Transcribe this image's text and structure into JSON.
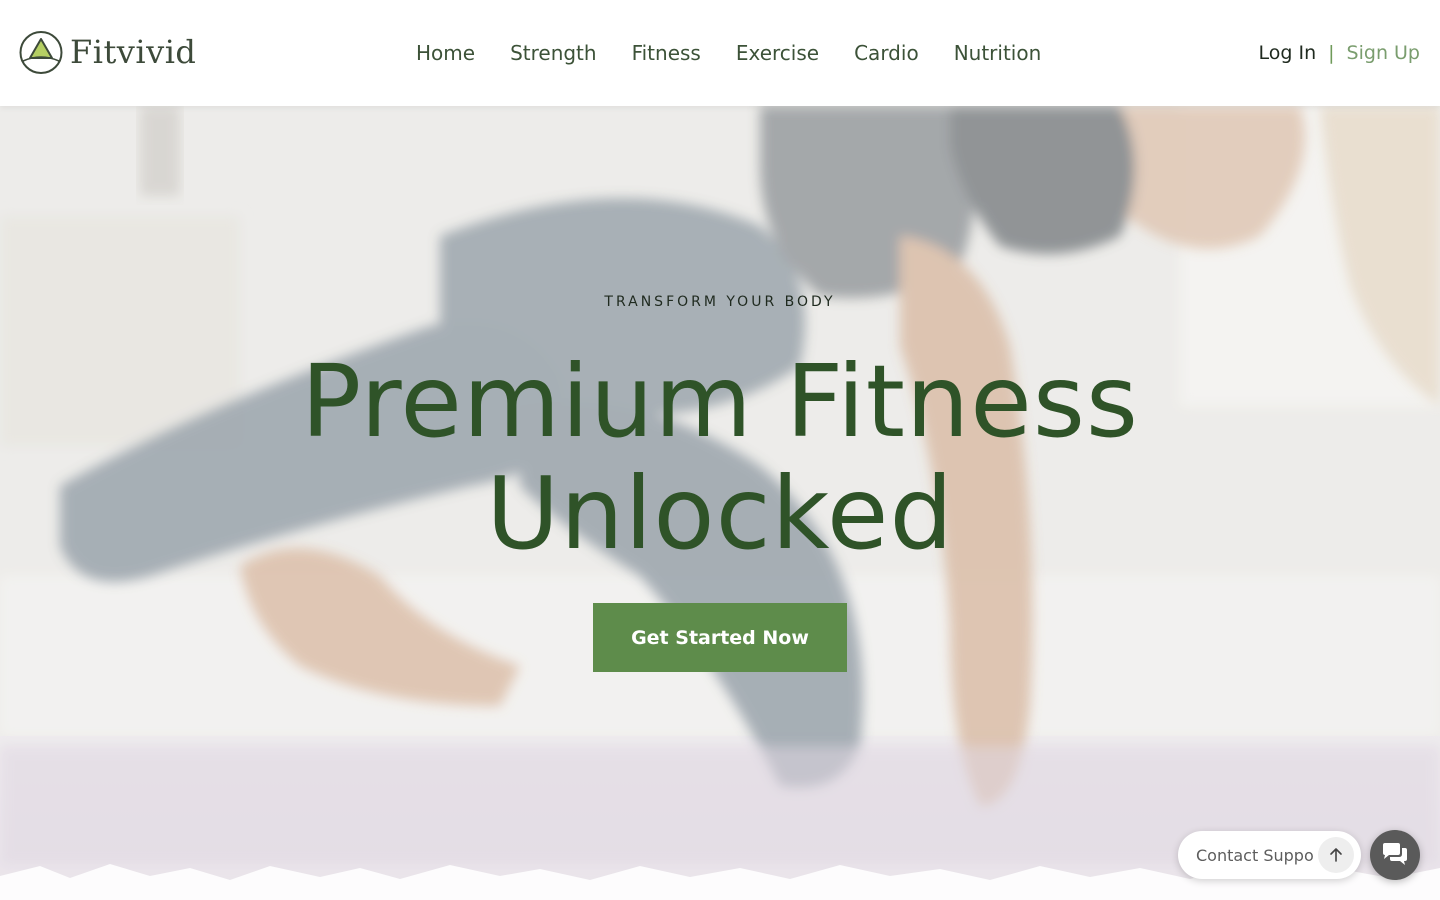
{
  "brand": {
    "name": "Fitvivid",
    "accent": "#5e8c4b",
    "heading_color": "#2f5328",
    "logo_icon": "triangle-badge-icon"
  },
  "nav": {
    "items": [
      {
        "label": "Home"
      },
      {
        "label": "Strength"
      },
      {
        "label": "Fitness"
      },
      {
        "label": "Exercise"
      },
      {
        "label": "Cardio"
      },
      {
        "label": "Nutrition"
      }
    ]
  },
  "auth": {
    "login": "Log In",
    "separator": "|",
    "signup": "Sign Up"
  },
  "hero": {
    "kicker": "TRANSFORM YOUR BODY",
    "title_line1": "Premium Fitness",
    "title_line2": "Unlocked",
    "cta": "Get Started Now",
    "background": "woman-stretching-photo"
  },
  "support": {
    "label": "Contact Support",
    "arrow_icon": "arrow-up-icon",
    "chat_icon": "chat-bubbles-icon"
  }
}
